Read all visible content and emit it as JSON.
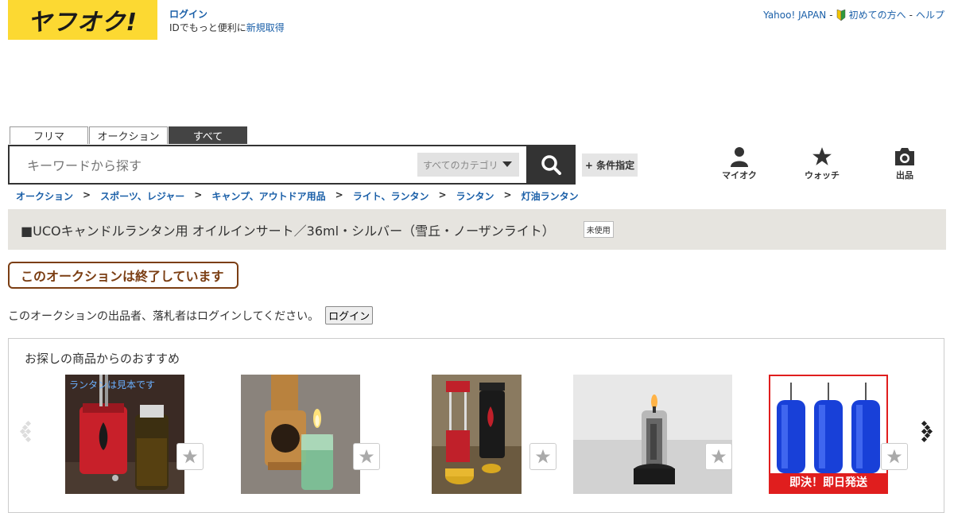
{
  "header": {
    "logo_text": "ヤフオク!",
    "login_link": "ログイン",
    "login_prompt": "IDでもっと便利に",
    "signup_link": "新規取得",
    "links": {
      "yahoo_japan": "Yahoo! JAPAN",
      "first_time": "初めての方へ",
      "help": "ヘルプ",
      "sep": "-"
    }
  },
  "tabs": [
    {
      "label": "フリマ",
      "active": false
    },
    {
      "label": "オークション",
      "active": false
    },
    {
      "label": "すべて",
      "active": true
    }
  ],
  "search": {
    "placeholder": "キーワードから探す",
    "category": "すべてのカテゴリ",
    "condition_button": "+ 条件指定"
  },
  "nav_icons": [
    {
      "label": "マイオク",
      "icon": "user-icon"
    },
    {
      "label": "ウォッチ",
      "icon": "star-icon"
    },
    {
      "label": "出品",
      "icon": "camera-icon"
    }
  ],
  "breadcrumb": [
    "オークション",
    "スポーツ、レジャー",
    "キャンプ、アウトドア用品",
    "ライト、ランタン",
    "ランタン",
    "灯油ランタン"
  ],
  "breadcrumb_sep": ">",
  "item": {
    "title": "■UCOキャンドルランタン用 オイルインサート／36ml・シルバー（雪丘・ノーザンライト）",
    "condition_badge": "未使用"
  },
  "status": {
    "ended_text": "このオークションは終了しています",
    "login_notice": "このオークションの出品者、落札者はログインしてください。",
    "login_button": "ログイン"
  },
  "recommend": {
    "title": "お探しの商品からのおすすめ",
    "items": [
      {
        "overlay_text": "ランタンは見本です"
      },
      {
        "overlay_text": ""
      },
      {
        "overlay_text": ""
      },
      {
        "overlay_text": ""
      },
      {
        "overlay_text": "即決！即日発送"
      }
    ]
  },
  "colors": {
    "brand_yellow": "#fcd932",
    "link_blue": "#1a5fa8",
    "ended_brown": "#7b3e13",
    "title_bg": "#e6e4df"
  }
}
